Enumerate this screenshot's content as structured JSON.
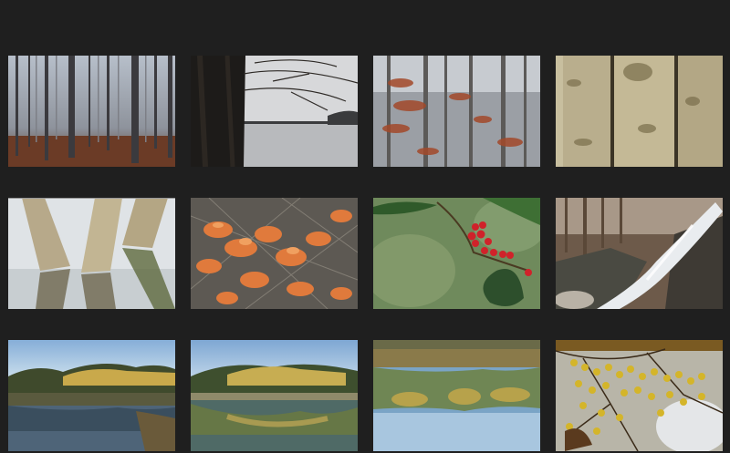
{
  "gallery": {
    "background": "#1f1f1f",
    "thumbnails": [
      {
        "subject": "misty-forest"
      },
      {
        "subject": "tree-by-lake"
      },
      {
        "subject": "bare-trees-orange-leaves"
      },
      {
        "subject": "tree-trunks-closeup"
      },
      {
        "subject": "trunks-reflected-in-water"
      },
      {
        "subject": "orange-leaves"
      },
      {
        "subject": "holly-berries"
      },
      {
        "subject": "waterfall"
      },
      {
        "subject": "lake-with-autumn-trees"
      },
      {
        "subject": "lake-reflection-sunlit-trees"
      },
      {
        "subject": "pond-reflection"
      },
      {
        "subject": "yellow-berries-branch"
      }
    ]
  }
}
